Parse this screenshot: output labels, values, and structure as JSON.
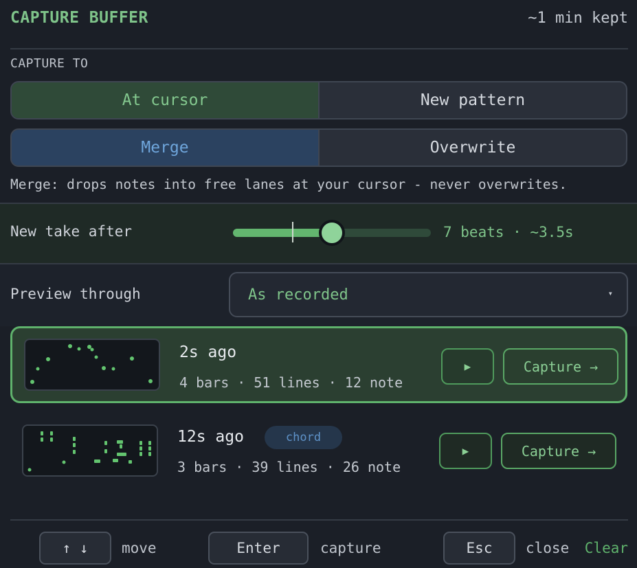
{
  "header": {
    "title": "CAPTURE BUFFER",
    "kept": "~1 min kept"
  },
  "capture_to": {
    "label": "CAPTURE TO",
    "target_options": [
      "At cursor",
      "New pattern"
    ],
    "target_selected": "At cursor",
    "mode_options": [
      "Merge",
      "Overwrite"
    ],
    "mode_selected": "Merge",
    "hint": "Merge: drops notes into free lanes at your cursor - never overwrites."
  },
  "new_take": {
    "label": "New take after",
    "value_text": "7 beats · ~3.5s",
    "slider_fraction": 0.5,
    "marker_fraction": 0.3
  },
  "preview": {
    "label": "Preview through",
    "selected": "As recorded",
    "caret": "▾"
  },
  "takes": [
    {
      "time": "2s ago",
      "meta": "4 bars · 51 lines · 12 note",
      "badge": "",
      "play": "▶",
      "capture": "Capture →",
      "selected": true
    },
    {
      "time": "12s ago",
      "meta": "3 bars · 39 lines · 26 note",
      "badge": "chord",
      "play": "▶",
      "capture": "Capture →",
      "selected": false
    }
  ],
  "footer": {
    "keys": [
      {
        "key": "↑ ↓",
        "action": "move"
      },
      {
        "key": "Enter",
        "action": "capture"
      },
      {
        "key": "Esc",
        "action": "close"
      }
    ],
    "clear": "Clear"
  },
  "colors": {
    "accent_green": "#7fc48a",
    "accent_blue": "#6fa6dc",
    "background": "#1b1f27"
  }
}
